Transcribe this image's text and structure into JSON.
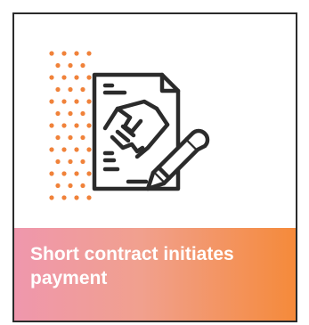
{
  "card": {
    "title": "Short contract initiates payment"
  },
  "icons": {
    "dot_pattern": "orange-dot-grid",
    "main": "contract-handshake-pen-icon"
  },
  "colors": {
    "dot_orange": "#f0823a",
    "outline": "#2b2b2b",
    "banner_start": "#ef97ad",
    "banner_end": "#f58a3a",
    "title_text": "#ffffff"
  }
}
